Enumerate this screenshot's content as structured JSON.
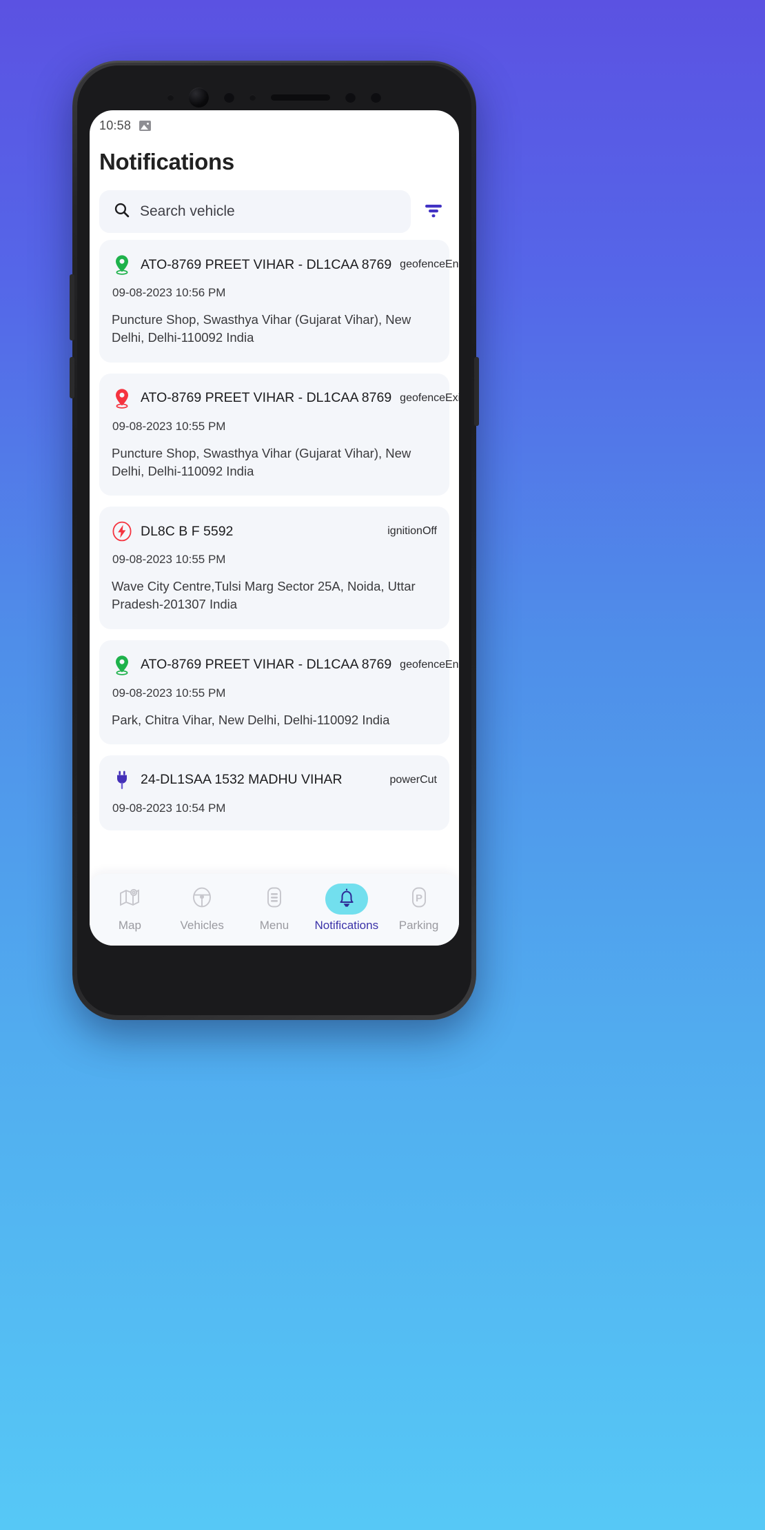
{
  "status_bar": {
    "time": "10:58",
    "icon": "image-icon"
  },
  "header": {
    "title": "Notifications"
  },
  "search": {
    "placeholder": "Search vehicle",
    "search_icon": "search-icon",
    "filter_icon": "filter-icon",
    "filter_color": "#4338ca"
  },
  "colors": {
    "background_top": "#5b52e2",
    "background_bottom": "#56c8f6",
    "card_bg": "#f4f6fa",
    "active_tab_pill": "#72dfee",
    "active_tab_text": "#3b32a8",
    "geofence_enter": "#1eb24b",
    "geofence_exit": "#f5333f",
    "ignition_off": "#f5333f",
    "power_cut": "#4430b8"
  },
  "notifications": [
    {
      "icon": "location-pin-icon",
      "icon_color": "#1eb24b",
      "title": "ATO-8769 PREET VIHAR - DL1CAA 8769",
      "type": "geofenceEnter",
      "timestamp": "09-08-2023 10:56 PM",
      "address": "Puncture Shop, Swasthya Vihar (Gujarat Vihar), New Delhi, Delhi-110092 India"
    },
    {
      "icon": "location-pin-icon",
      "icon_color": "#f5333f",
      "title": "ATO-8769 PREET VIHAR - DL1CAA 8769",
      "type": "geofenceExit",
      "timestamp": "09-08-2023 10:55 PM",
      "address": "Puncture Shop, Swasthya Vihar (Gujarat Vihar), New Delhi, Delhi-110092 India"
    },
    {
      "icon": "ignition-bolt-icon",
      "icon_color": "#f5333f",
      "title": "DL8C B F 5592",
      "type": "ignitionOff",
      "timestamp": "09-08-2023 10:55 PM",
      "address": "Wave City Centre,Tulsi Marg Sector 25A, Noida, Uttar Pradesh-201307 India"
    },
    {
      "icon": "location-pin-icon",
      "icon_color": "#1eb24b",
      "title": "ATO-8769 PREET VIHAR - DL1CAA 8769",
      "type": "geofenceEnter",
      "timestamp": "09-08-2023 10:55 PM",
      "address": "Park, Chitra Vihar, New Delhi, Delhi-110092 India"
    },
    {
      "icon": "power-plug-icon",
      "icon_color": "#4430b8",
      "title": "24-DL1SAA 1532 MADHU VIHAR",
      "type": "powerCut",
      "timestamp": "09-08-2023 10:54 PM",
      "address": ""
    }
  ],
  "bottom_nav": {
    "items": [
      {
        "label": "Map",
        "icon": "map-pin-route-icon",
        "active": false
      },
      {
        "label": "Vehicles",
        "icon": "steering-wheel-icon",
        "active": false
      },
      {
        "label": "Menu",
        "icon": "list-menu-icon",
        "active": false
      },
      {
        "label": "Notifications",
        "icon": "bell-icon",
        "active": true
      },
      {
        "label": "Parking",
        "icon": "parking-p-icon",
        "active": false
      }
    ]
  }
}
